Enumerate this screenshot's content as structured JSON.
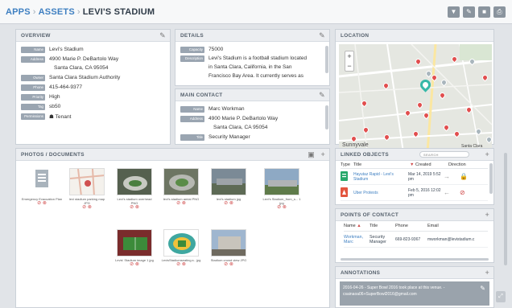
{
  "breadcrumb": {
    "apps": "Apps",
    "assets": "Assets",
    "current": "Levi's Stadium"
  },
  "overview": {
    "title": "Overview",
    "fields": [
      {
        "label": "Name",
        "value": "Levi's Stadium"
      },
      {
        "label": "Address",
        "value": "4900 Marie P. DeBartolo Way"
      },
      {
        "label": "",
        "value": "Santa Clara, CA 95054"
      },
      {
        "label": "Owner",
        "value": "Santa Clara Stadium Authority"
      },
      {
        "label": "Phone",
        "value": "415-464-9377"
      },
      {
        "label": "Priority",
        "value": "High"
      },
      {
        "label": "Tag",
        "value": "sb50"
      },
      {
        "label": "Permissions",
        "value": "Tenant"
      }
    ]
  },
  "details": {
    "title": "Details",
    "capacity_label": "Capacity",
    "capacity": "75000",
    "description_label": "Description",
    "description_lines": [
      "Levi's Stadium is a football stadium located",
      "in Santa Clara, California, in the San",
      "Francisco Bay Area. It currently serves as"
    ]
  },
  "main_contact": {
    "title": "Main contact",
    "name_label": "Name",
    "name": "Marc Workman",
    "address_label": "Address",
    "address1": "4900 Marie P. DeBartolo Way",
    "address2": "Santa Clara, CA 95054",
    "title_label": "Title",
    "job_title": "Security Manager"
  },
  "location": {
    "title": "Location",
    "cities": [
      "Sunnyvale",
      "Santa Clara"
    ]
  },
  "documents": {
    "title": "Photos / Documents",
    "items": [
      {
        "name": "Emergency Evacuation Plan",
        "kind": "doc"
      },
      {
        "name": "levi stadium parking map JPG",
        "kind": "map"
      },
      {
        "name": "Levi's stadium overhead PNG",
        "kind": "photo"
      },
      {
        "name": "levi's stadium aerial PNG",
        "kind": "photo"
      },
      {
        "name": "levi's stadium jpg",
        "kind": "photo"
      },
      {
        "name": "Levi's Stadium_from_s... 1 jpg",
        "kind": "photo"
      },
      {
        "name": "Levis' Stadium image 1 jpg",
        "kind": "field"
      },
      {
        "name": "LevisStadiumseating.s.. jpg",
        "kind": "seat"
      },
      {
        "name": "Stadium crowd view JPG",
        "kind": "photo"
      }
    ]
  },
  "linked": {
    "title": "Linked objects",
    "search_placeholder": "Search",
    "headers": {
      "type": "Type",
      "title": "Title",
      "created": "Created",
      "direction": "Direction"
    },
    "rows": [
      {
        "title": "Hayutaz Rapid - Levi's Stadium",
        "created": "Mar 14, 2019 5:52 pm",
        "dir": "→"
      },
      {
        "title": "Uber Protests",
        "created": "Feb 5, 2016 12:02 pm",
        "dir": "←"
      }
    ]
  },
  "poc": {
    "title": "Points of contact",
    "headers": {
      "name": "Name",
      "title": "Title",
      "phone": "Phone",
      "email": "Email"
    },
    "row": {
      "name": "Workman, Marc",
      "title": "Security Manager",
      "phone": "669-823-9367",
      "email": "mworkman@levistadium.c"
    }
  },
  "annotations": {
    "title": "Annotations",
    "text": "2016-04-26 - Super Bowl 2016 took place at this venue. - csainaoa06+SuperBowl2016@gmail.com"
  }
}
